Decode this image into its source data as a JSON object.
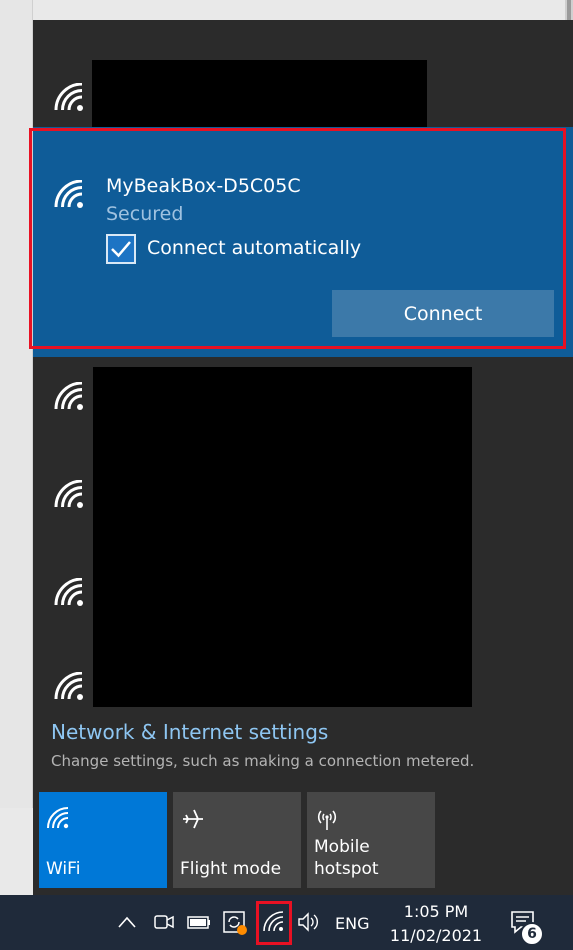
{
  "network_list": {
    "selected": {
      "name": "MyBeakBox-D5C05C",
      "status": "Secured",
      "auto_connect_label": "Connect automatically",
      "auto_connect_checked": true,
      "connect_label": "Connect"
    }
  },
  "settings": {
    "link": "Network & Internet settings",
    "description": "Change settings, such as making a connection metered."
  },
  "quick_actions": [
    {
      "label": "WiFi",
      "active": true,
      "icon": "wifi-icon"
    },
    {
      "label": "Flight mode",
      "active": false,
      "icon": "airplane-icon"
    },
    {
      "label_line1": "Mobile",
      "label_line2": "hotspot",
      "active": false,
      "icon": "hotspot-icon"
    }
  ],
  "taskbar": {
    "language": "ENG",
    "time": "1:05 PM",
    "date": "11/02/2021",
    "notification_count": "6"
  },
  "colors": {
    "flyout_bg": "#2b2b2b",
    "selected_bg": "#0f5c98",
    "accent": "#0078d7",
    "highlight_outline": "#e81123",
    "taskbar_bg": "#1f2a3a"
  }
}
